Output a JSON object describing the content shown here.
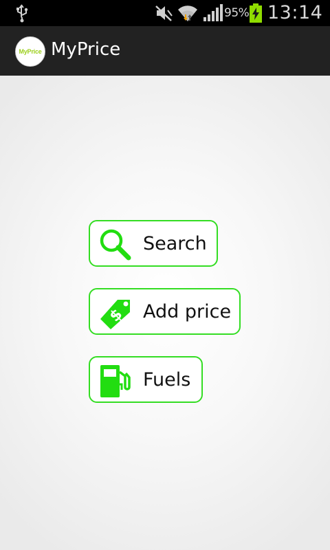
{
  "status_bar": {
    "battery_percent": "95%",
    "time": "13:14",
    "icons": [
      "usb-icon",
      "mute-icon",
      "wifi-icon",
      "signal-icon",
      "battery-charging-icon"
    ]
  },
  "action_bar": {
    "logo_text": "MyPrice",
    "title": "MyPrice"
  },
  "menu": {
    "items": [
      {
        "label": "Search",
        "icon": "magnifier-icon"
      },
      {
        "label": "Add price",
        "icon": "price-tag-icon"
      },
      {
        "label": "Fuels",
        "icon": "fuel-pump-icon"
      }
    ]
  },
  "colors": {
    "accent_green": "#33dd22",
    "logo_green": "#9ccf1c",
    "battery_green": "#8fdc00",
    "status_bar_bg": "#000000",
    "action_bar_bg": "#222222"
  }
}
